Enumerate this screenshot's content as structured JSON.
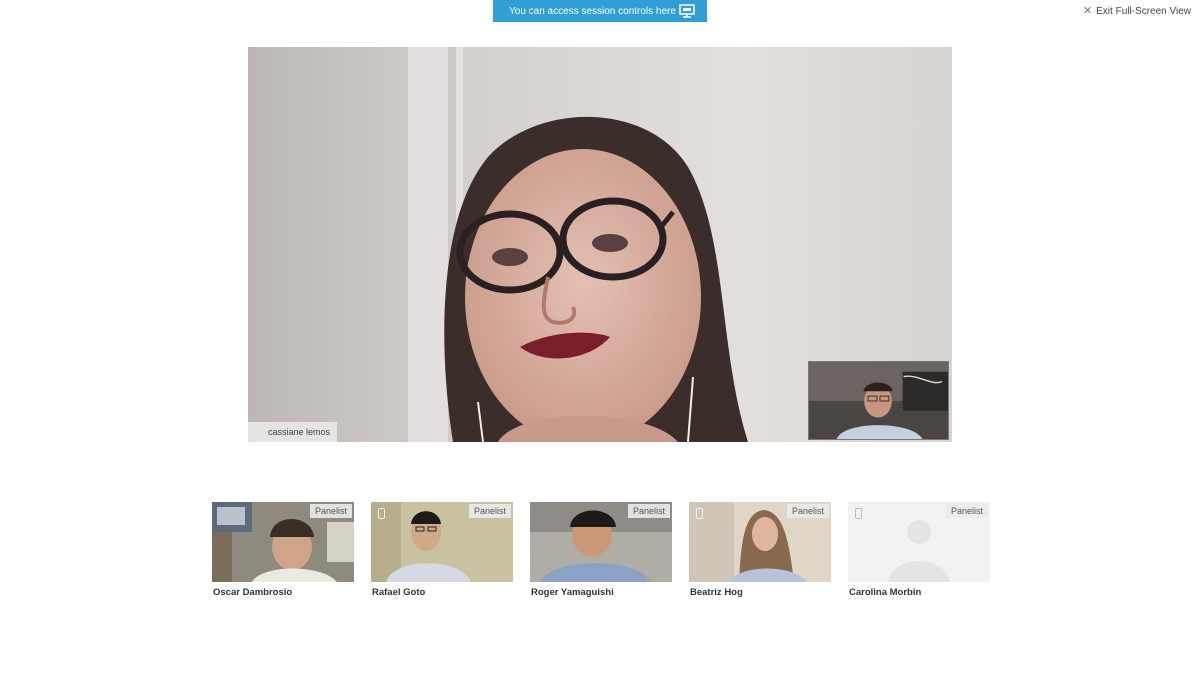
{
  "session_banner": {
    "text": "You can access session controls here",
    "icon": "monitor-icon",
    "color": "#2f9fd6"
  },
  "exit_fullscreen": {
    "label": "Exit Full-Screen View",
    "icon": "close-icon"
  },
  "main_video": {
    "speaker_name": "cassiane lemos"
  },
  "panelists": [
    {
      "name": "Oscar Dambrosio",
      "badge": "Panelist"
    },
    {
      "name": "Rafael Goto",
      "badge": "Panelist"
    },
    {
      "name": "Roger Yamaguishi",
      "badge": "Panelist"
    },
    {
      "name": "Beatriz Hog",
      "badge": "Panelist"
    },
    {
      "name": "Carolina Morbin",
      "badge": "Panelist"
    }
  ]
}
